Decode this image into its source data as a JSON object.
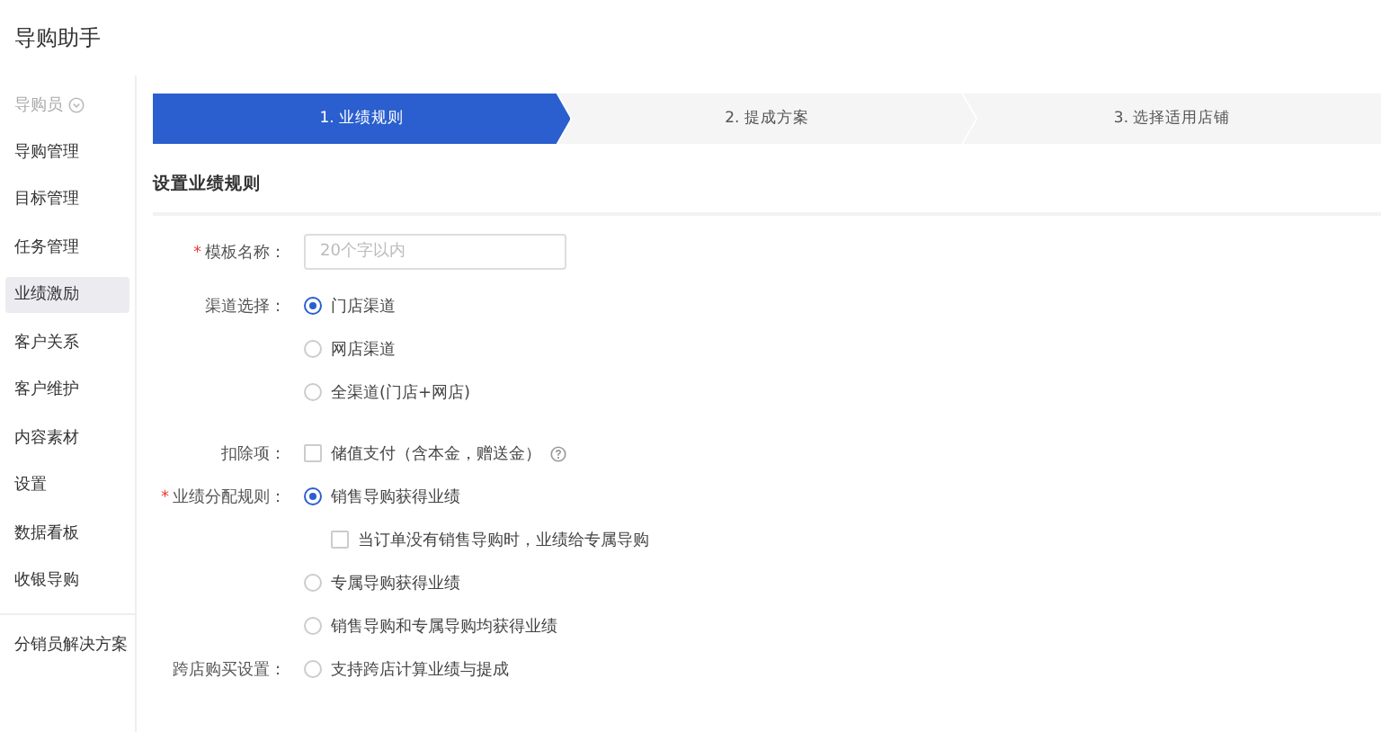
{
  "app_title": "导购助手",
  "sidebar": {
    "role": {
      "label": "导购员"
    },
    "items": [
      {
        "label": "导购管理",
        "selected": false
      },
      {
        "label": "目标管理",
        "selected": false
      },
      {
        "label": "任务管理",
        "selected": false
      },
      {
        "label": "业绩激励",
        "selected": true
      },
      {
        "label": "客户关系",
        "selected": false
      },
      {
        "label": "客户维护",
        "selected": false
      },
      {
        "label": "内容素材",
        "selected": false
      },
      {
        "label": "设置",
        "selected": false
      },
      {
        "label": "数据看板",
        "selected": false
      },
      {
        "label": "收银导购",
        "selected": false
      }
    ],
    "extra_items": [
      {
        "label": "分销员解决方案",
        "selected": false
      }
    ]
  },
  "steps": [
    {
      "label": "1. 业绩规则",
      "selected": true
    },
    {
      "label": "2. 提成方案",
      "selected": false
    },
    {
      "label": "3. 选择适用店铺",
      "selected": false
    }
  ],
  "section_title": "设置业绩规则",
  "form": [
    {
      "label": "模板名称：",
      "required_mark": "*",
      "kind": "input",
      "placeholder": "20个字以内"
    },
    {
      "label": "渠道选择：",
      "kind": "options",
      "options": [
        {
          "kind": "radio",
          "label": "门店渠道",
          "selected": true
        },
        {
          "kind": "radio",
          "label": "网店渠道",
          "selected": false
        },
        {
          "kind": "radio",
          "label": "全渠道(门店+网店)",
          "selected": false
        }
      ]
    },
    {
      "label": "扣除项：",
      "kind": "options",
      "options": [
        {
          "kind": "checkbox",
          "label": "储值支付（含本金，赠送金）",
          "checked": false,
          "help": true
        }
      ]
    },
    {
      "label": "业绩分配规则：",
      "required_mark": "*",
      "kind": "options",
      "options": [
        {
          "kind": "radio",
          "label": "销售导购获得业绩",
          "selected": true,
          "children": [
            {
              "kind": "checkbox",
              "label": "当订单没有销售导购时，业绩给专属导购",
              "checked": false
            }
          ]
        },
        {
          "kind": "radio",
          "label": "专属导购获得业绩",
          "selected": false
        },
        {
          "kind": "radio",
          "label": "销售导购和专属导购均获得业绩",
          "selected": false
        }
      ]
    },
    {
      "label": "跨店购买设置：",
      "kind": "options",
      "options": [
        {
          "kind": "radio",
          "label": "支持跨店计算业绩与提成",
          "selected": false
        }
      ]
    }
  ]
}
